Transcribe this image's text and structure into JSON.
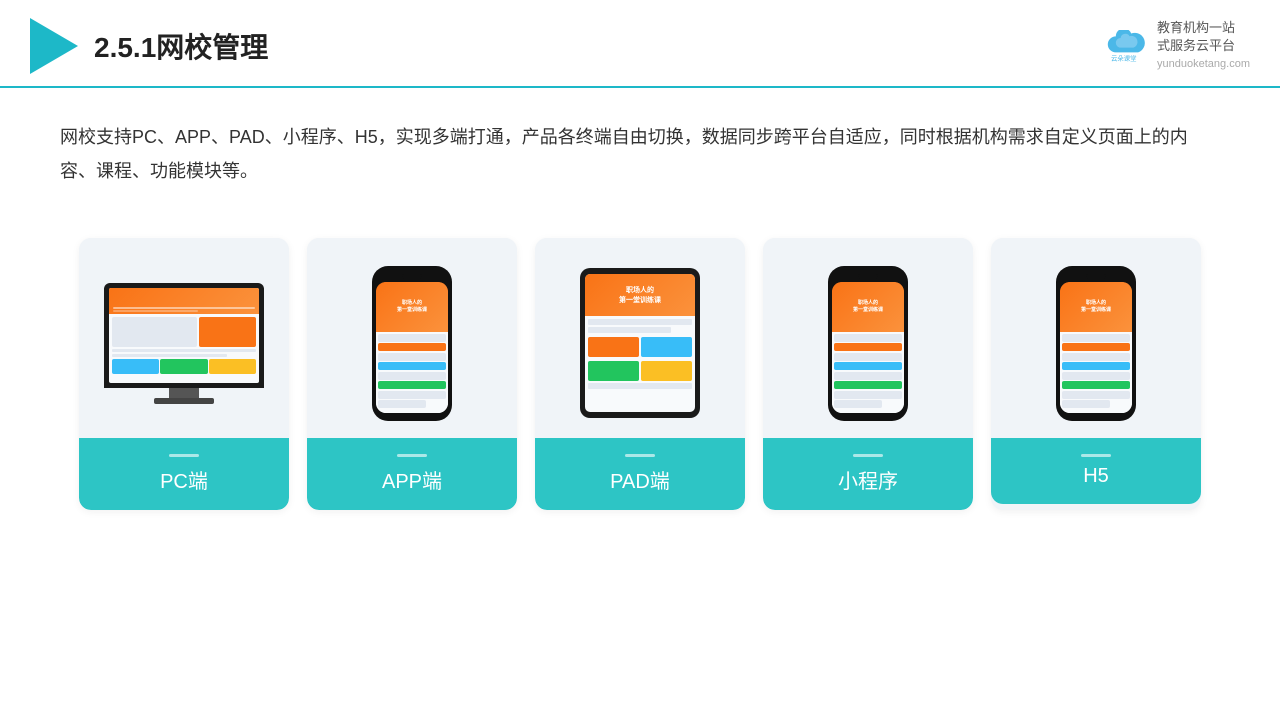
{
  "header": {
    "title": "2.5.1网校管理",
    "brand_name": "云朵课堂",
    "brand_url": "yunduoketang.com",
    "brand_tagline": "教育机构一站\n式服务云平台"
  },
  "description": "网校支持PC、APP、PAD、小程序、H5，实现多端打通，产品各终端自由切换，数据同步跨平台自适应，同时根据机构需求自定义页面上的内容、课程、功能模块等。",
  "cards": [
    {
      "id": "pc",
      "label": "PC端",
      "device": "pc"
    },
    {
      "id": "app",
      "label": "APP端",
      "device": "phone"
    },
    {
      "id": "pad",
      "label": "PAD端",
      "device": "tablet"
    },
    {
      "id": "miniapp",
      "label": "小程序",
      "device": "phone"
    },
    {
      "id": "h5",
      "label": "H5",
      "device": "phone"
    }
  ]
}
